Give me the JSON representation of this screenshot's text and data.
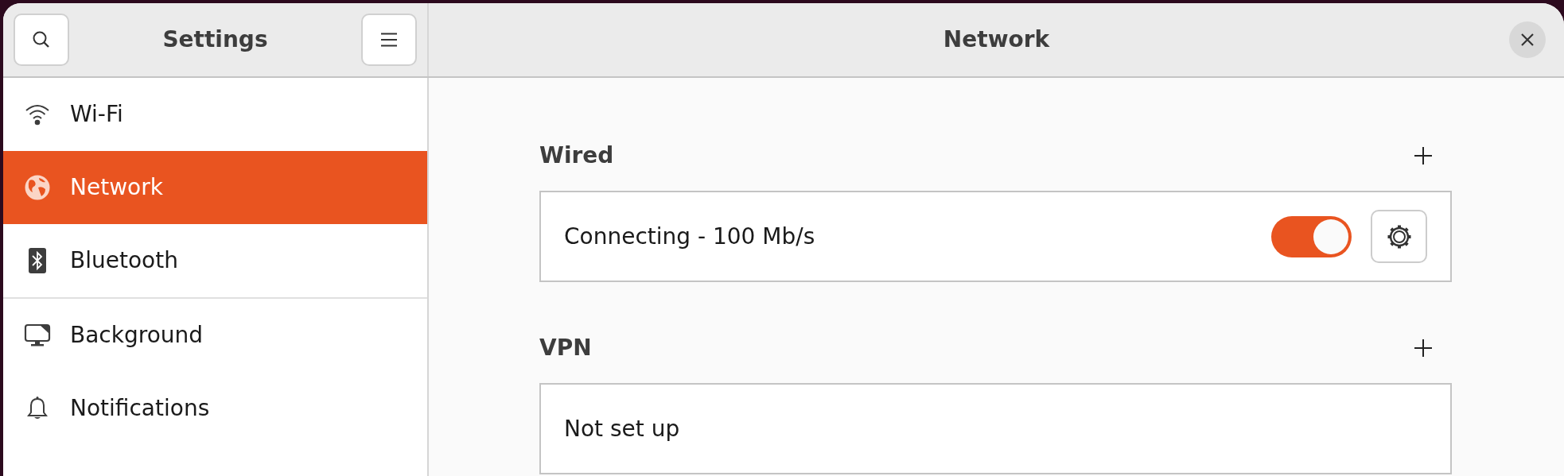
{
  "window": {
    "title": "Network"
  },
  "sidebar": {
    "title": "Settings",
    "groups": [
      [
        {
          "label": "Wi-Fi",
          "kind": "wifi",
          "selected": false
        },
        {
          "label": "Network",
          "kind": "network",
          "selected": true
        },
        {
          "label": "Bluetooth",
          "kind": "bluetooth",
          "selected": false
        }
      ],
      [
        {
          "label": "Background",
          "kind": "background",
          "selected": false
        },
        {
          "label": "Notifications",
          "kind": "notifications",
          "selected": false
        }
      ]
    ]
  },
  "sections": [
    {
      "title": "Wired",
      "rows": [
        {
          "label": "Connecting - 100 Mb/s",
          "toggle": {
            "on": true
          },
          "settings_button": true
        }
      ]
    },
    {
      "title": "VPN",
      "rows": [
        {
          "label": "Not set up"
        }
      ]
    }
  ]
}
